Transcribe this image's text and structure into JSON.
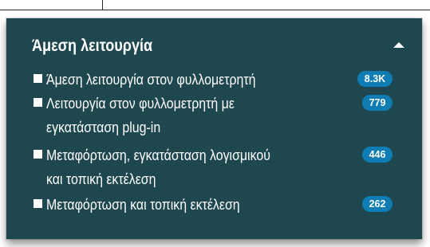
{
  "panel": {
    "title": "Άμεση λειτουργία",
    "collapse_icon": "caret-up-icon",
    "items": [
      {
        "lines": [
          "Άμεση λειτουργία στον φυλλομετρητή"
        ],
        "count": "8.3K"
      },
      {
        "lines": [
          "Λειτουργία στον φυλλομετρητή με",
          "εγκατάσταση plug-in"
        ],
        "count": "779"
      },
      {
        "lines": [
          "Μεταφόρτωση, εγκατάσταση λογισμικού",
          "και τοπική εκτέλεση"
        ],
        "count": "446"
      },
      {
        "lines": [
          "Μεταφόρτωση και τοπική εκτέλεση"
        ],
        "count": "262"
      }
    ]
  },
  "colors": {
    "panel_background": "#1f474f",
    "badge_background": "#0f7db3",
    "text": "#ffffff"
  }
}
